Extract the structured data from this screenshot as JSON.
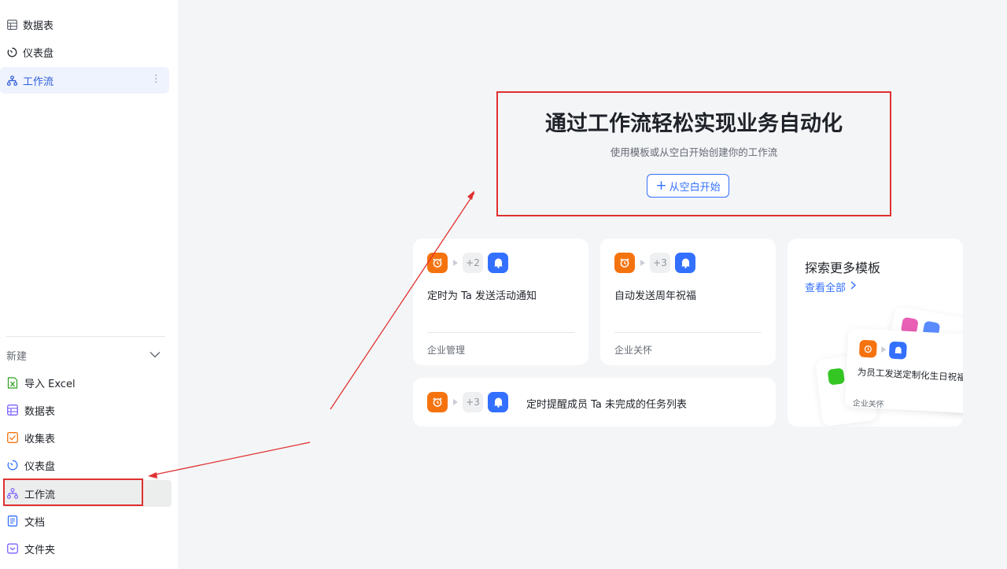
{
  "sidebar": {
    "top_items": [
      {
        "label": "数据表",
        "icon": "table-icon"
      },
      {
        "label": "仪表盘",
        "icon": "dashboard-icon"
      },
      {
        "label": "工作流",
        "icon": "workflow-icon",
        "active": true
      }
    ],
    "new_section": {
      "header": "新建",
      "items": [
        {
          "label": "导入 Excel",
          "icon": "excel-icon"
        },
        {
          "label": "数据表",
          "icon": "table-icon"
        },
        {
          "label": "收集表",
          "icon": "form-icon"
        },
        {
          "label": "仪表盘",
          "icon": "dashboard-icon"
        },
        {
          "label": "工作流",
          "icon": "workflow-icon",
          "selected": true
        },
        {
          "label": "文档",
          "icon": "document-icon"
        },
        {
          "label": "文件夹",
          "icon": "folder-icon"
        }
      ]
    }
  },
  "hero": {
    "title": "通过工作流轻松实现业务自动化",
    "subtitle": "使用模板或从空白开始创建你的工作流",
    "start_button": "从空白开始"
  },
  "templates": [
    {
      "title": "定时为 Ta 发送活动通知",
      "count": "+2",
      "category": "企业管理"
    },
    {
      "title": "自动发送周年祝福",
      "count": "+3",
      "category": "企业关怀"
    },
    {
      "title": "定时提醒成员 Ta 未完成的任务列表",
      "count": "+3"
    }
  ],
  "explore": {
    "title": "探索更多模板",
    "view_all": "查看全部",
    "preview_card": {
      "title": "为员工发送定制化生日祝福",
      "category": "企业关怀"
    }
  },
  "colors": {
    "accent": "#3370ff",
    "trigger": "#f5730f",
    "annotation": "#e03030"
  }
}
